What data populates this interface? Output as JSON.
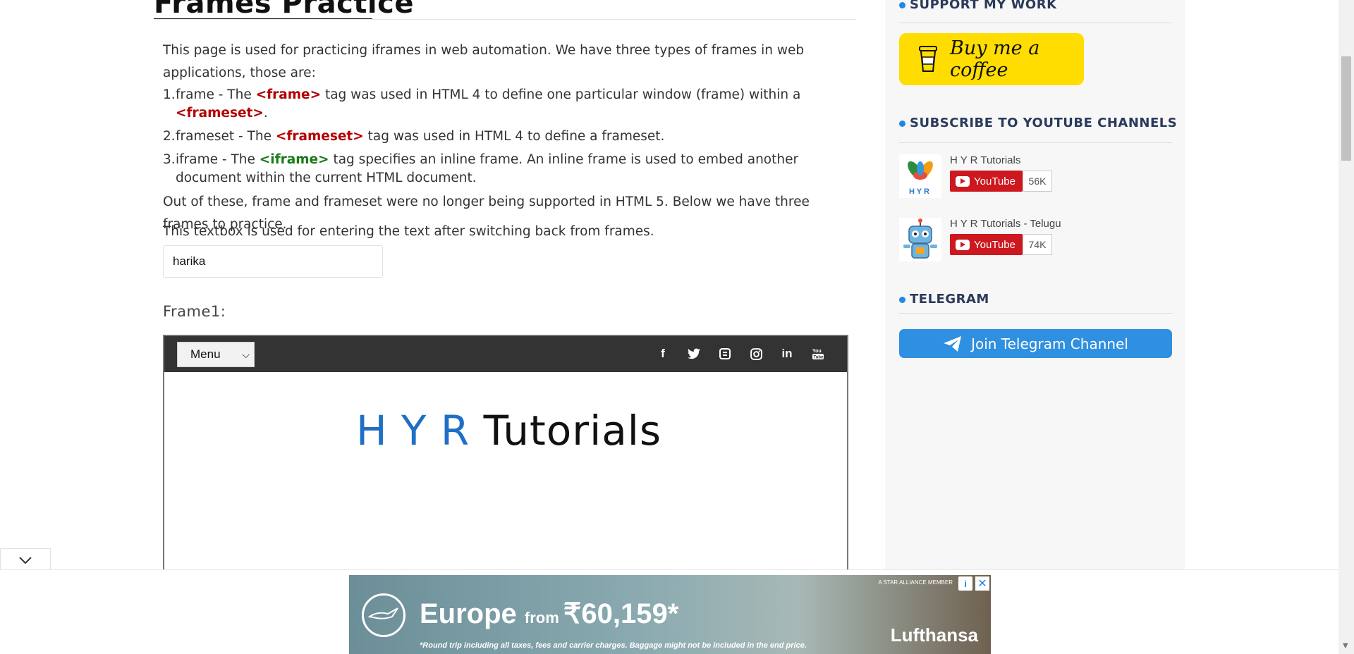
{
  "page": {
    "title": "Frames Practice"
  },
  "content": {
    "intro": "This page is used for practicing iframes in web automation. We have three types of frames in web applications, those are:",
    "items": [
      {
        "num": "1.",
        "pre": "frame - The ",
        "tag1": "<frame>",
        "mid": " tag was used in HTML 4 to define one particular window (frame) within a ",
        "tag2": "<frameset>",
        "post": "."
      },
      {
        "num": "2.",
        "pre": "frameset - The ",
        "tag1": "<frameset>",
        "mid": " tag was used in HTML 4 to define a frameset."
      },
      {
        "num": "3.",
        "pre": "iframe - The ",
        "tag1": "<iframe>",
        "mid": " tag specifies an inline frame. An inline frame is used to embed another document within the current HTML document."
      }
    ],
    "outro": "Out of these, frame and frameset were no longer being supported in HTML 5. Below we have three frames to practice.",
    "textbox_label": "This textbox is used for entering the text after switching back from frames.",
    "textbox_value": "harika",
    "frame_label": "Frame1:"
  },
  "frame1": {
    "menu_value": "Menu",
    "social_icons": [
      "facebook-icon",
      "twitter-icon",
      "blogger-icon",
      "instagram-icon",
      "linkedin-icon",
      "youtube-icon"
    ],
    "logo_hyr": "H Y R",
    "logo_tutorials": "Tutorials"
  },
  "sidebar": {
    "support_heading": "SUPPORT MY WORK",
    "coffee_label": "Buy me a coffee",
    "subscribe_heading": "SUBSCRIBE TO YOUTUBE CHANNELS",
    "channels": [
      {
        "name": "H Y R Tutorials",
        "button": "YouTube",
        "count": "56K"
      },
      {
        "name": "H Y R Tutorials - Telugu",
        "button": "YouTube",
        "count": "74K"
      }
    ],
    "telegram_heading": "TELEGRAM",
    "telegram_button": "Join Telegram Channel"
  },
  "ad": {
    "headline_1": "Europe ",
    "headline_from": "from ",
    "headline_price": "₹60,159*",
    "fine_print": "*Round trip including all taxes, fees and carrier charges. Baggage might not be included in the end price.",
    "member": "A STAR ALLIANCE MEMBER",
    "brand": "Lufthansa",
    "info_glyph": "i",
    "close_glyph": "✕"
  },
  "colors": {
    "accent": "#1e88e5",
    "tag_red": "#b30000",
    "tag_green": "#1a7a1a",
    "coffee_yellow": "#ffdd00",
    "youtube_red": "#cc181e",
    "telegram_blue": "#2f8fe0"
  }
}
